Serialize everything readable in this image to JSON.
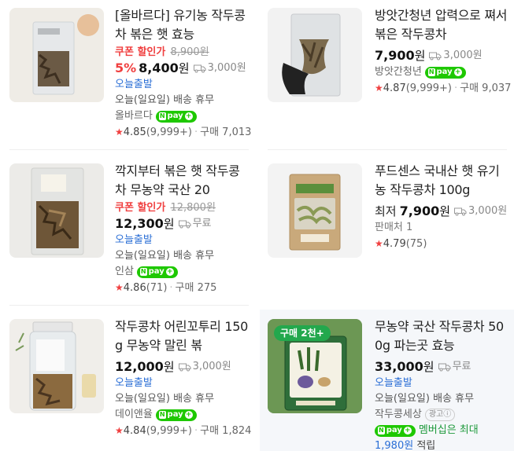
{
  "products": [
    {
      "title": "[올바르다] 유기농 작두콩차 볶은 햇 효능",
      "coupon": "쿠폰 할인가",
      "original_price": "8,900원",
      "discount": "5%",
      "price": "8,400",
      "won": "원",
      "shipping": "3,000원",
      "delivery_tag": "오늘출발",
      "delivery_note": "오늘(일요일) 배송 휴무",
      "seller": "올바르다",
      "npay": "pay",
      "rating": "4.85",
      "reviews": "(9,999+)",
      "purchases": "구매 7,013",
      "image_icon": "tea-bag-product-image"
    },
    {
      "title": "방앗간청년 압력으로 쪄서 볶은 작두콩차",
      "price": "7,900",
      "won": "원",
      "shipping": "3,000원",
      "seller": "방앗간청년",
      "npay": "pay",
      "rating": "4.87",
      "reviews": "(9,999+)",
      "purchases": "구매 9,037",
      "image_icon": "hand-holding-tea-bag-image"
    },
    {
      "title": "깍지부터 볶은 햇 작두콩차 무농약 국산 20",
      "coupon": "쿠폰 할인가",
      "original_price": "12,800원",
      "price": "12,300",
      "won": "원",
      "shipping": "무료",
      "delivery_tag": "오늘출발",
      "delivery_note": "오늘(일요일) 배송 휴무",
      "seller": "인삼",
      "npay": "pay",
      "rating": "4.86",
      "reviews": "(71)",
      "purchases": "구매 275",
      "image_icon": "tea-bag-product-image"
    },
    {
      "title": "푸드센스 국내산 햇 유기농 작두콩차 100g",
      "price_prefix": "최저",
      "price": "7,900",
      "won": "원",
      "shipping": "3,000원",
      "seller_count": "판매처 1",
      "rating": "4.79",
      "reviews": "(75)",
      "image_icon": "kraft-tea-bag-image"
    },
    {
      "title": "작두콩차 어린꼬투리 150g 무농약 말린 볶",
      "price": "12,000",
      "won": "원",
      "shipping": "3,000원",
      "delivery_tag": "오늘출발",
      "delivery_note": "오늘(일요일) 배송 휴무",
      "seller": "데이앤율",
      "npay": "pay",
      "rating": "4.84",
      "reviews": "(9,999+)",
      "purchases": "구매 1,824",
      "image_icon": "tea-jar-image"
    },
    {
      "title": "무농약 국산 작두콩차 500g 파는곳 효능",
      "buy_badge": "구매 2천+",
      "price": "33,000",
      "won": "원",
      "shipping": "무료",
      "delivery_tag": "오늘출발",
      "delivery_note": "오늘(일요일) 배송 휴무",
      "seller": "작두콩세상",
      "ad_label": "광고ⓘ",
      "npay": "pay",
      "member_text": "멤버십은 최대",
      "points": "1,980원",
      "points_suffix": "적립",
      "image_icon": "green-tea-pouch-image"
    }
  ],
  "colors": {
    "accent_red": "#f04040",
    "link_blue": "#2b6fd6",
    "npay_green": "#1ec800",
    "member_green": "#1e9a3c"
  }
}
